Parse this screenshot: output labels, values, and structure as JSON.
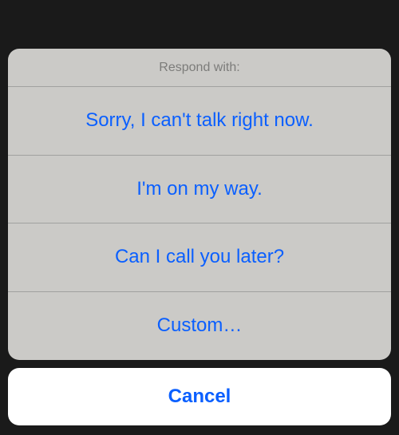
{
  "sheet": {
    "title": "Respond with:",
    "options": [
      "Sorry, I can't talk right now.",
      "I'm on my way.",
      "Can I call you later?",
      "Custom…"
    ],
    "cancel_label": "Cancel"
  }
}
